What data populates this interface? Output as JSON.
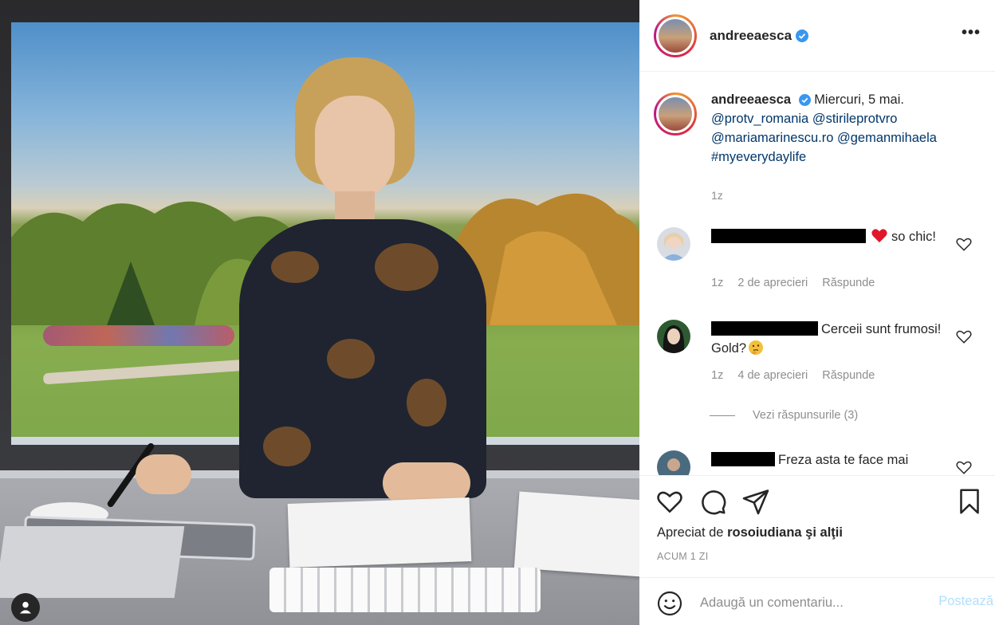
{
  "post": {
    "author": "andreeaesca",
    "verified": true,
    "more_icon": "more-horizontal-icon"
  },
  "caption": {
    "username": "andreeaesca",
    "text": "Miercuri, 5 mai.",
    "links": [
      "@protv_romania",
      "@stirileprotvro",
      "@mariamarinescu.ro",
      "@gemanmihaela",
      "#myeverydaylife"
    ],
    "time": "1z"
  },
  "comments": [
    {
      "text_before": "",
      "emoji": "heart",
      "text": "so chic!",
      "time": "1z",
      "likes": "2 de aprecieri",
      "reply_label": "Răspunde"
    },
    {
      "text": "Cerceii sunt frumosi! Gold?",
      "emoji": "thinking-face",
      "time": "1z",
      "likes": "4 de aprecieri",
      "reply_label": "Răspunde",
      "view_replies": "Vezi răspunsurile (3)"
    },
    {
      "text": "Freza asta te face mai"
    }
  ],
  "actions": {
    "icons": [
      "heart-icon",
      "comment-icon",
      "share-icon",
      "bookmark-icon"
    ],
    "liked_by_prefix": "Apreciat de",
    "liked_by_user": "rosoiudiana",
    "liked_by_suffix": "şi alţii",
    "ago": "ACUM 1 ZI"
  },
  "composer": {
    "placeholder": "Adaugă un comentariu...",
    "post_label": "Postează"
  },
  "colors": {
    "link": "#00376b",
    "muted": "#8e8e8e",
    "verified": "#3897f0",
    "like_red": "#ed4956",
    "post_disabled": "#b2dffc"
  }
}
